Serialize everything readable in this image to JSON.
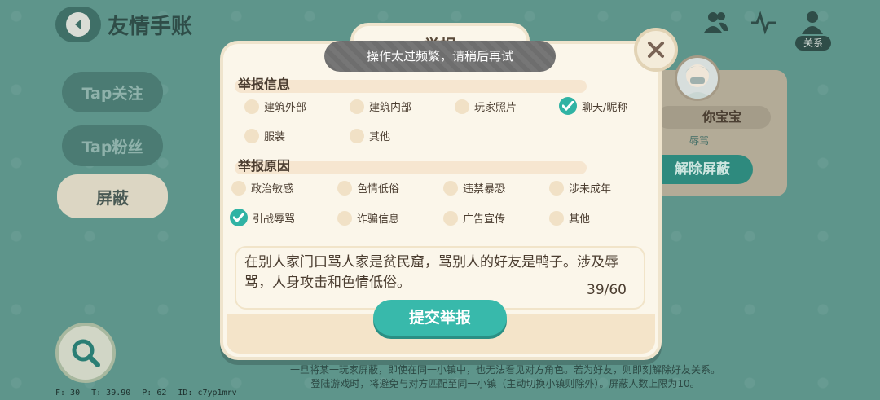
{
  "header": {
    "title": "友情手账",
    "relation_label": "关系",
    "icons": [
      "friends-icon",
      "activity-icon",
      "relation-icon"
    ]
  },
  "sidebar": {
    "items": [
      {
        "label": "Tap关注"
      },
      {
        "label": "Tap粉丝"
      },
      {
        "label": "屏蔽"
      }
    ]
  },
  "friend_card": {
    "name": "你宝宝",
    "tag": "辱骂",
    "unblock_label": "解除屏蔽"
  },
  "footer": {
    "note_line1": "一旦将某一玩家屏蔽，即使在同一小镇中，也无法看见对方角色。若为好友，则即刻解除好友关系。",
    "note_line2": "登陆游戏时，将避免与对方匹配至同一小镇（主动切换小镇则除外）。屏蔽人数上限为10。"
  },
  "stats": {
    "f": "F: 30",
    "t": "T: 39.90",
    "p": "P: 62",
    "id": "ID: c7yp1mrv"
  },
  "modal": {
    "title": "举报",
    "toast": "操作太过频繁，请稍后再试",
    "section_info": "举报信息",
    "info_options": [
      {
        "label": "建筑外部",
        "checked": false
      },
      {
        "label": "建筑内部",
        "checked": false
      },
      {
        "label": "玩家照片",
        "checked": false
      },
      {
        "label": "聊天/昵称",
        "checked": true
      },
      {
        "label": "服装",
        "checked": false
      },
      {
        "label": "其他",
        "checked": false
      }
    ],
    "section_reason": "举报原因",
    "reason_options": [
      {
        "label": "政治敏感",
        "checked": false
      },
      {
        "label": "色情低俗",
        "checked": false
      },
      {
        "label": "违禁暴恐",
        "checked": false
      },
      {
        "label": "涉未成年",
        "checked": false
      },
      {
        "label": "引战辱骂",
        "checked": true
      },
      {
        "label": "诈骗信息",
        "checked": false
      },
      {
        "label": "广告宣传",
        "checked": false
      },
      {
        "label": "其他",
        "checked": false
      }
    ],
    "description": "在别人家门口骂人家是贫民窟，骂别人的好友是鸭子。涉及辱骂，人身攻击和色情低俗。",
    "counter": "39/60",
    "submit_label": "提交举报"
  },
  "colors": {
    "accent": "#38b9ab",
    "modal_bg": "#fbf6ea",
    "backdrop": "#5e958b"
  }
}
